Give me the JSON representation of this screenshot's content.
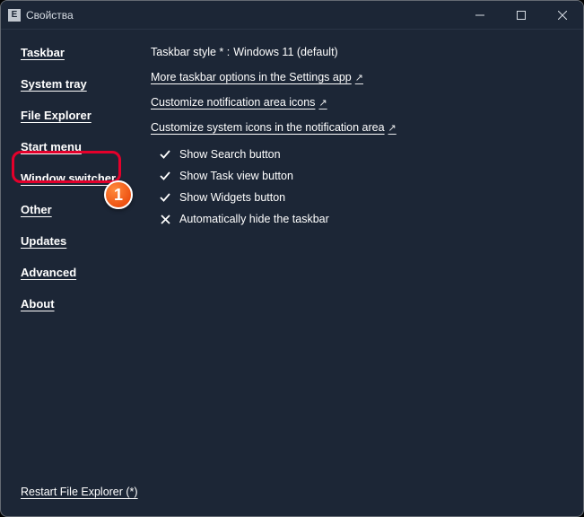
{
  "window": {
    "title": "Свойства",
    "icon_letter": "E"
  },
  "sidebar": {
    "items": [
      {
        "label": "Taskbar"
      },
      {
        "label": "System tray"
      },
      {
        "label": "File Explorer"
      },
      {
        "label": "Start menu"
      },
      {
        "label": "Window switcher"
      },
      {
        "label": "Other"
      },
      {
        "label": "Updates"
      },
      {
        "label": "Advanced"
      },
      {
        "label": "About"
      }
    ]
  },
  "annotation": {
    "badge_number": "1"
  },
  "content": {
    "taskbar_style_label": "Taskbar style * :",
    "taskbar_style_value": "Windows 11 (default)",
    "links": [
      "More taskbar options in the Settings app",
      "Customize notification area icons",
      "Customize system icons in the notification area"
    ],
    "options": [
      {
        "checked": true,
        "label": "Show Search button"
      },
      {
        "checked": true,
        "label": "Show Task view button"
      },
      {
        "checked": true,
        "label": "Show Widgets button"
      },
      {
        "checked": false,
        "label": "Automatically hide the taskbar"
      }
    ]
  },
  "footer": {
    "restart_label": "Restart File Explorer (*)"
  }
}
